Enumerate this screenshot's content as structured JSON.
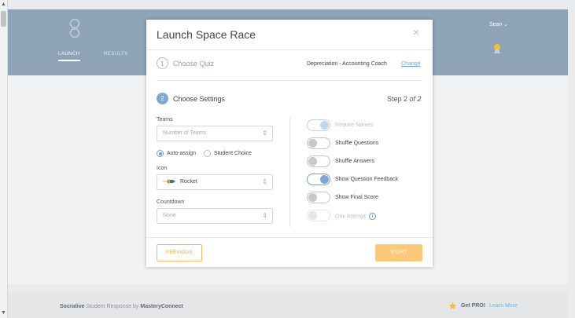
{
  "colors": {
    "header": "#8ea3b6",
    "accent_blue": "#7fa9d1",
    "accent_orange": "#f0a640"
  },
  "header": {
    "nav": {
      "launch": "LAUNCH",
      "results": "RESULTS"
    },
    "user": "Sean ⌄"
  },
  "modal": {
    "title": "Launch Space Race",
    "close": "×",
    "step1": {
      "number": "1",
      "label": "Choose Quiz",
      "quiz_name": "Depreciation - Accounting Coach",
      "change": "Change"
    },
    "step2": {
      "number": "2",
      "label": "Choose Settings",
      "count_prefix": "Step 2",
      "count_suffix": "of 2"
    },
    "teams": {
      "label": "Teams",
      "value": "Number of Teams"
    },
    "team_assign": {
      "auto": "Auto-assign",
      "choice": "Student Choice",
      "selected": "auto"
    },
    "icon": {
      "label": "Icon",
      "value": "Rocket",
      "icon_name": "rocket-icon"
    },
    "countdown": {
      "label": "Countdown",
      "value": "None"
    },
    "toggles": [
      {
        "label": "Require Names",
        "state": "on",
        "disabled": true
      },
      {
        "label": "Shuffle Questions",
        "state": "off",
        "disabled": false
      },
      {
        "label": "Shuffle Answers",
        "state": "off",
        "disabled": false
      },
      {
        "label": "Show Question Feedback",
        "state": "on",
        "disabled": false
      },
      {
        "label": "Show Final Score",
        "state": "off",
        "disabled": false
      },
      {
        "label": "One Attempt",
        "state": "off",
        "disabled": true
      }
    ],
    "buttons": {
      "previous": "PREVIOUS",
      "start": "START"
    }
  },
  "footer": {
    "brand": "Socrative",
    "brand_mid": "Student Response by",
    "brand_company": "MasteryConnect",
    "pro": "Get PRO!",
    "learn_more": "Learn More"
  }
}
